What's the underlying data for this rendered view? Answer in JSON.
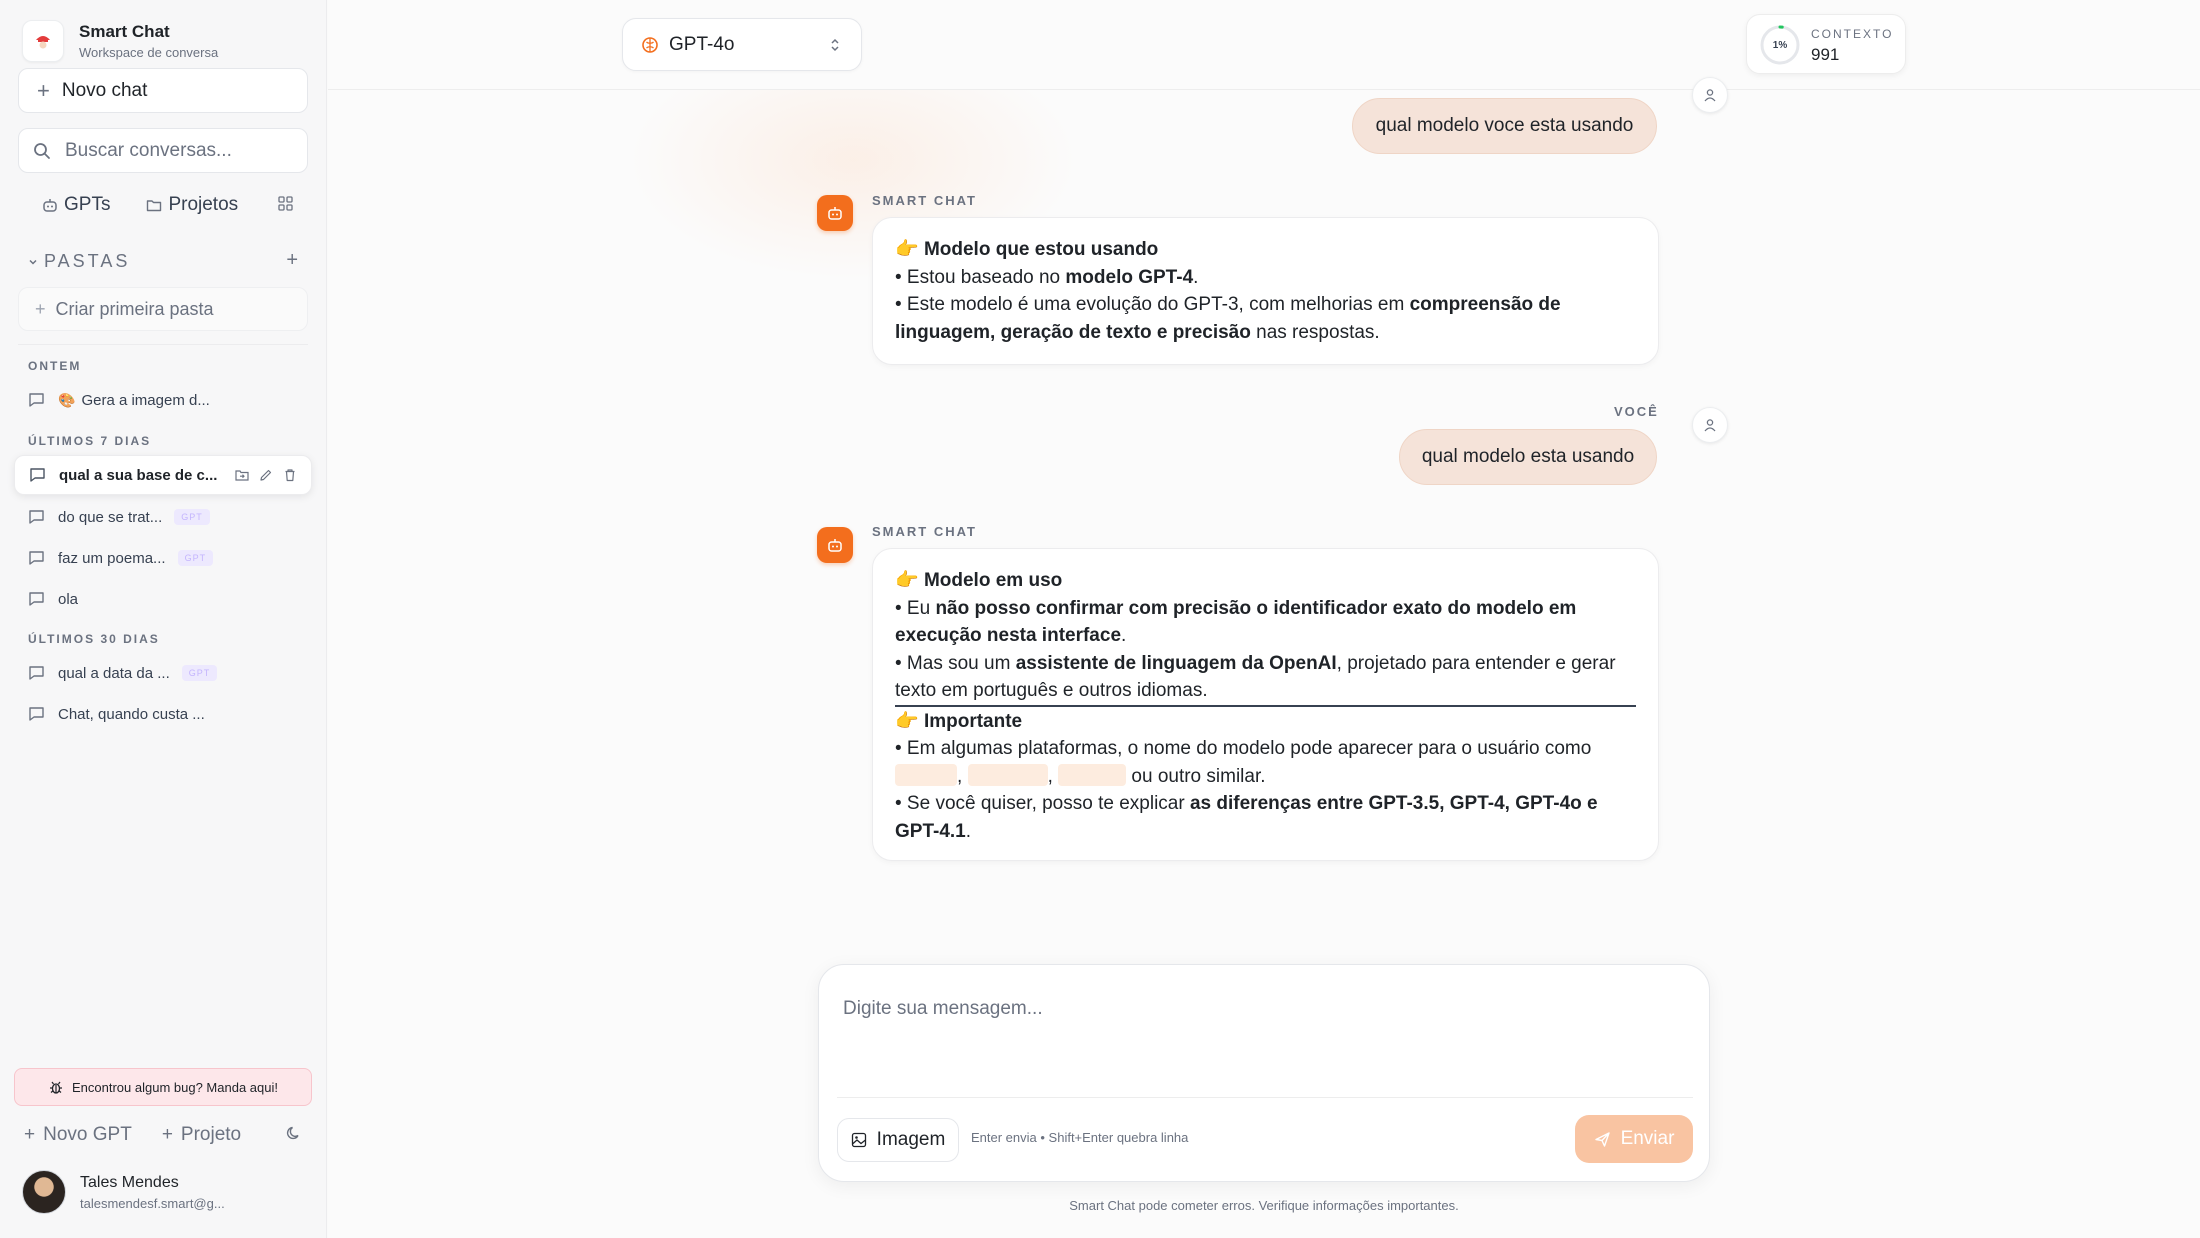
{
  "sidebar": {
    "brand": {
      "title": "Smart Chat",
      "subtitle": "Workspace de conversa"
    },
    "new_chat": "Novo chat",
    "search_placeholder": "Buscar conversas...",
    "nav": {
      "gpts": "GPTs",
      "projects": "Projetos"
    },
    "folders": {
      "title": "PASTAS",
      "add": "+",
      "create_first": "Criar primeira pasta"
    },
    "groups": [
      {
        "label": "ONTEM",
        "items": [
          {
            "title": "Gera a imagem d...",
            "emoji": "🎨"
          }
        ]
      },
      {
        "label": "ÚLTIMOS 7 DIAS",
        "items": [
          {
            "title": "qual a sua base de c...",
            "active": true
          },
          {
            "title": "do que se trat...",
            "badge": "GPT"
          },
          {
            "title": "faz um poema...",
            "badge": "GPT"
          },
          {
            "title": "ola"
          }
        ]
      },
      {
        "label": "ÚLTIMOS 30 DIAS",
        "items": [
          {
            "title": "qual a data da ...",
            "badge": "GPT"
          },
          {
            "title": "Chat, quando custa ..."
          }
        ]
      }
    ],
    "bug_report": "Encontrou algum bug? Manda aqui!",
    "bottom": {
      "new_gpt": "Novo GPT",
      "project": "Projeto"
    },
    "user": {
      "name": "Tales Mendes",
      "email": "talesmendesf.smart@g..."
    }
  },
  "topbar": {
    "model": "GPT-4o",
    "context": {
      "label": "CONTEXTO",
      "value": "991",
      "percent_text": "1%",
      "percent": 0.01
    }
  },
  "messages": {
    "user1": "qual modelo voce esta usando",
    "bot1": {
      "sender": "SMART CHAT",
      "heading_emoji": "👉",
      "heading": "Modelo que estou usando",
      "l1_a": "• Estou baseado no ",
      "l1_b": "modelo GPT-4",
      "l1_c": ".",
      "l2_a": "• Este modelo é uma evolução do GPT-3, com melhorias em ",
      "l2_b": "compreensão de",
      "l3_a": "linguagem, geração de texto e precisão",
      "l3_b": " nas respostas."
    },
    "user2": {
      "sender": "VOCÊ",
      "text": "qual modelo esta usando"
    },
    "bot2": {
      "sender": "SMART CHAT",
      "h1_emoji": "👉",
      "h1": "Modelo em uso",
      "a1": "• Eu ",
      "a2": "não posso confirmar com precisão o identificador exato do modelo em",
      "a3": "execução nesta interface",
      "a4": ".",
      "b1": "• Mas sou um ",
      "b2": "assistente de linguagem da OpenAI",
      "b3": ", projetado para entender e gerar",
      "b4": "texto em português e outros idiomas.",
      "h2_emoji": "👉",
      "h2": "Importante",
      "c1": "• Em algumas plataformas, o nome do modelo pode aparecer para o usuário como",
      "c_sep1": ",",
      "c_sep2": ",",
      "c2": " ou outro similar.",
      "d1": "• Se você quiser, posso te explicar ",
      "d2": "as diferenças entre GPT-3.5, GPT-4, GPT-4o e",
      "d3": "GPT-4.1",
      "d4": "."
    }
  },
  "composer": {
    "placeholder": "Digite sua mensagem...",
    "image_button": "Imagem",
    "hint": "Enter envia • Shift+Enter quebra linha",
    "send": "Enviar",
    "disclaimer": "Smart Chat pode cometer erros. Verifique informações importantes."
  },
  "colors": {
    "accent": "#f36e1d",
    "user_bubble": "#f5e3d9",
    "send_disabled": "#f9c4a2",
    "badge_bg": "#ede9fe"
  }
}
